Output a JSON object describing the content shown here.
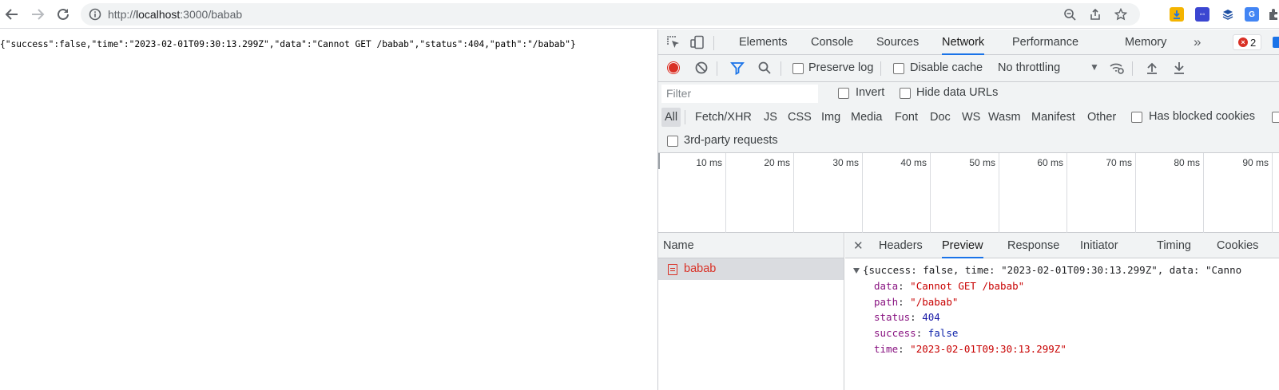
{
  "browser": {
    "url_prefix": "http://",
    "url_host": "localhost",
    "url_rest": ":3000/babab"
  },
  "page": {
    "raw_json": "{\"success\":false,\"time\":\"2023-02-01T09:30:13.299Z\",\"data\":\"Cannot GET /babab\",\"status\":404,\"path\":\"/babab\"}"
  },
  "devtools": {
    "tabs": [
      "Elements",
      "Console",
      "Sources",
      "Network",
      "Performance",
      "Memory"
    ],
    "active_tab": "Network",
    "error_count": "2",
    "network": {
      "preserve_log": "Preserve log",
      "disable_cache": "Disable cache",
      "throttling": "No throttling",
      "filter_placeholder": "Filter",
      "invert": "Invert",
      "hide_data_urls": "Hide data URLs",
      "types": [
        "All",
        "Fetch/XHR",
        "JS",
        "CSS",
        "Img",
        "Media",
        "Font",
        "Doc",
        "WS",
        "Wasm",
        "Manifest",
        "Other"
      ],
      "active_type": "All",
      "has_blocked_cookies": "Has blocked cookies",
      "third_party": "3rd-party requests",
      "timeline_ticks": [
        "10 ms",
        "20 ms",
        "30 ms",
        "40 ms",
        "50 ms",
        "60 ms",
        "70 ms",
        "80 ms",
        "90 ms"
      ],
      "name_header": "Name",
      "requests": [
        {
          "name": "babab",
          "status": "error"
        }
      ],
      "detail_tabs": [
        "Headers",
        "Preview",
        "Response",
        "Initiator",
        "Timing",
        "Cookies"
      ],
      "active_detail_tab": "Preview",
      "preview": {
        "summary": "{success: false, time: \"2023-02-01T09:30:13.299Z\", data: \"Canno",
        "fields": [
          {
            "key": "data",
            "value": "\"Cannot GET /babab\"",
            "type": "string"
          },
          {
            "key": "path",
            "value": "\"/babab\"",
            "type": "string"
          },
          {
            "key": "status",
            "value": "404",
            "type": "number"
          },
          {
            "key": "success",
            "value": "false",
            "type": "boolean"
          },
          {
            "key": "time",
            "value": "\"2023-02-01T09:30:13.299Z\"",
            "type": "string"
          }
        ]
      }
    }
  },
  "colors": {
    "accent": "#1a73e8",
    "error": "#d93025",
    "string": "#c80000",
    "key": "#881280"
  },
  "icons": [
    "back-icon",
    "forward-icon",
    "reload-icon",
    "info-icon",
    "zoom-icon",
    "share-icon",
    "bookmark-star-icon",
    "download-ext-icon",
    "discord-ext-icon",
    "layers-ext-icon",
    "translate-ext-icon",
    "puzzle-icon",
    "inspect-icon",
    "device-icon",
    "more-tabs-icon",
    "record-icon",
    "clear-icon",
    "filter-icon",
    "search-icon",
    "wifi-settings-icon",
    "upload-icon",
    "download-icon",
    "close-icon"
  ]
}
